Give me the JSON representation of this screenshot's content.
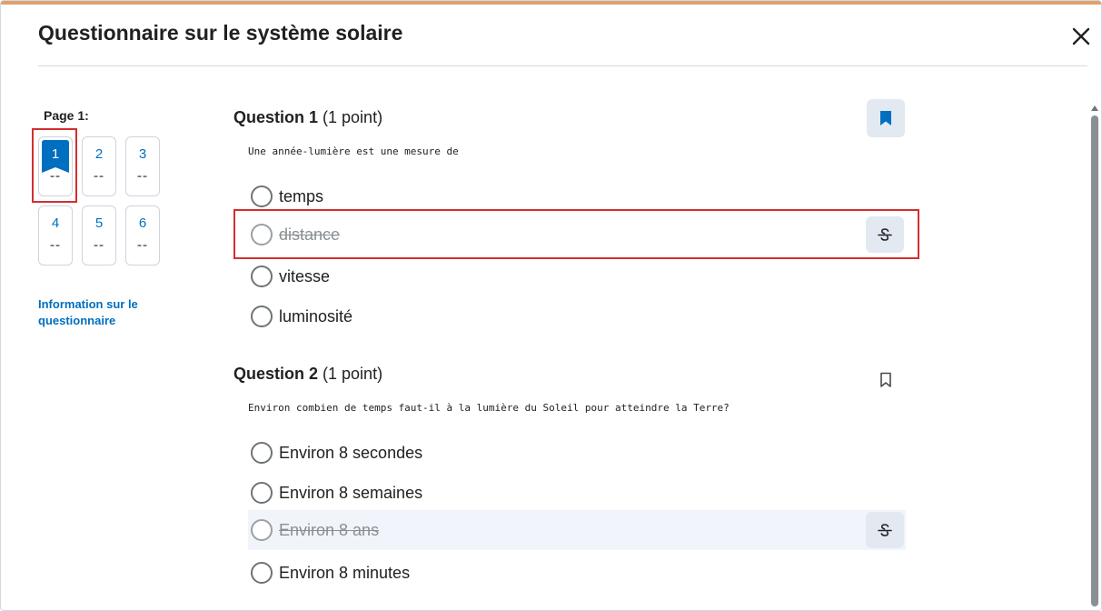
{
  "dialog": {
    "title": "Questionnaire sur le système solaire",
    "close_icon": "close-icon"
  },
  "nav": {
    "page_label": "Page 1:",
    "questions": [
      {
        "num": "1",
        "status": "--",
        "current": true
      },
      {
        "num": "2",
        "status": "--"
      },
      {
        "num": "3",
        "status": "--"
      },
      {
        "num": "4",
        "status": "--"
      },
      {
        "num": "5",
        "status": "--"
      },
      {
        "num": "6",
        "status": "--"
      }
    ],
    "info_link": "Information sur le questionnaire"
  },
  "questions": [
    {
      "title": "Question 1",
      "points": "(1 point)",
      "text": "Une année-lumière est une mesure de",
      "bookmarked": true,
      "options": [
        {
          "label": "temps",
          "struck": false
        },
        {
          "label": "distance",
          "struck": true
        },
        {
          "label": "vitesse",
          "struck": false
        },
        {
          "label": "luminosité",
          "struck": false
        }
      ]
    },
    {
      "title": "Question 2",
      "points": "(1 point)",
      "text": "Environ combien de temps faut-il à la lumière du Soleil pour atteindre la Terre?",
      "bookmarked": false,
      "options": [
        {
          "label": "Environ 8 secondes",
          "struck": false
        },
        {
          "label": "Environ 8 semaines",
          "struck": false
        },
        {
          "label": "Environ 8 ans",
          "struck": true
        },
        {
          "label": "Environ 8 minutes",
          "struck": false
        }
      ]
    }
  ],
  "colors": {
    "accent": "#006fbf",
    "highlight": "#d32f2f",
    "top_accent": "#e0a06c"
  }
}
